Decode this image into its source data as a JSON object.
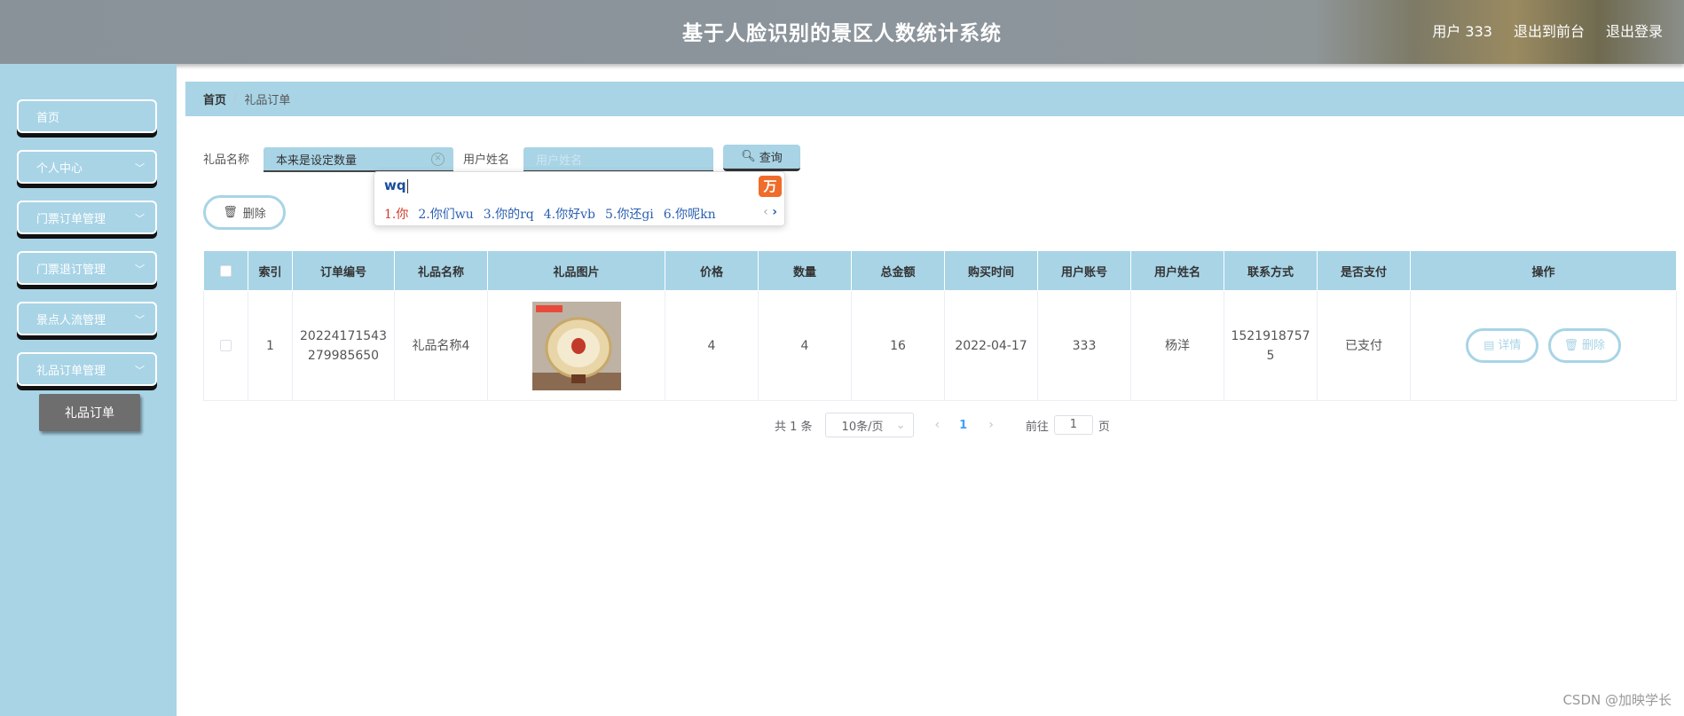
{
  "header": {
    "title": "基于人脸识别的景区人数统计系统",
    "user": "用户 333",
    "back_front": "退出到前台",
    "logout": "退出登录"
  },
  "sidebar": {
    "items": [
      {
        "label": "首页",
        "expandable": false
      },
      {
        "label": "个人中心",
        "expandable": true
      },
      {
        "label": "门票订单管理",
        "expandable": true
      },
      {
        "label": "门票退订管理",
        "expandable": true
      },
      {
        "label": "景点人流管理",
        "expandable": true
      },
      {
        "label": "礼品订单管理",
        "expandable": true
      }
    ],
    "active_sub": "礼品订单"
  },
  "breadcrumb": {
    "home": "首页",
    "sep": "/",
    "current": "礼品订单"
  },
  "search": {
    "gift_label": "礼品名称",
    "gift_value": "本来是设定数量",
    "user_label": "用户姓名",
    "user_placeholder": "用户姓名",
    "query_btn": "查询"
  },
  "ime": {
    "composition": "wq",
    "candidates": [
      "1.你",
      "2.你们wu",
      "3.你的rq",
      "4.你好vb",
      "5.你还gi",
      "6.你呢kn"
    ],
    "logo": "万"
  },
  "toolbar": {
    "delete_btn": "删除"
  },
  "table": {
    "headers": [
      "索引",
      "订单编号",
      "礼品名称",
      "礼品图片",
      "价格",
      "数量",
      "总金额",
      "购买时间",
      "用户账号",
      "用户姓名",
      "联系方式",
      "是否支付",
      "操作"
    ],
    "rows": [
      {
        "index": "1",
        "order_no": "20224171543279985650",
        "gift_name": "礼品名称4",
        "price": "4",
        "qty": "4",
        "total": "16",
        "time": "2022-04-17",
        "account": "333",
        "user_name": "杨洋",
        "phone": "15219187575",
        "paid": "已支付",
        "detail_btn": "详情",
        "delete_btn": "删除"
      }
    ]
  },
  "pagination": {
    "total": "共 1 条",
    "page_size": "10条/页",
    "current": "1",
    "goto_prefix": "前往",
    "goto_value": "1",
    "goto_suffix": "页"
  },
  "watermark": "CSDN @加映学长"
}
